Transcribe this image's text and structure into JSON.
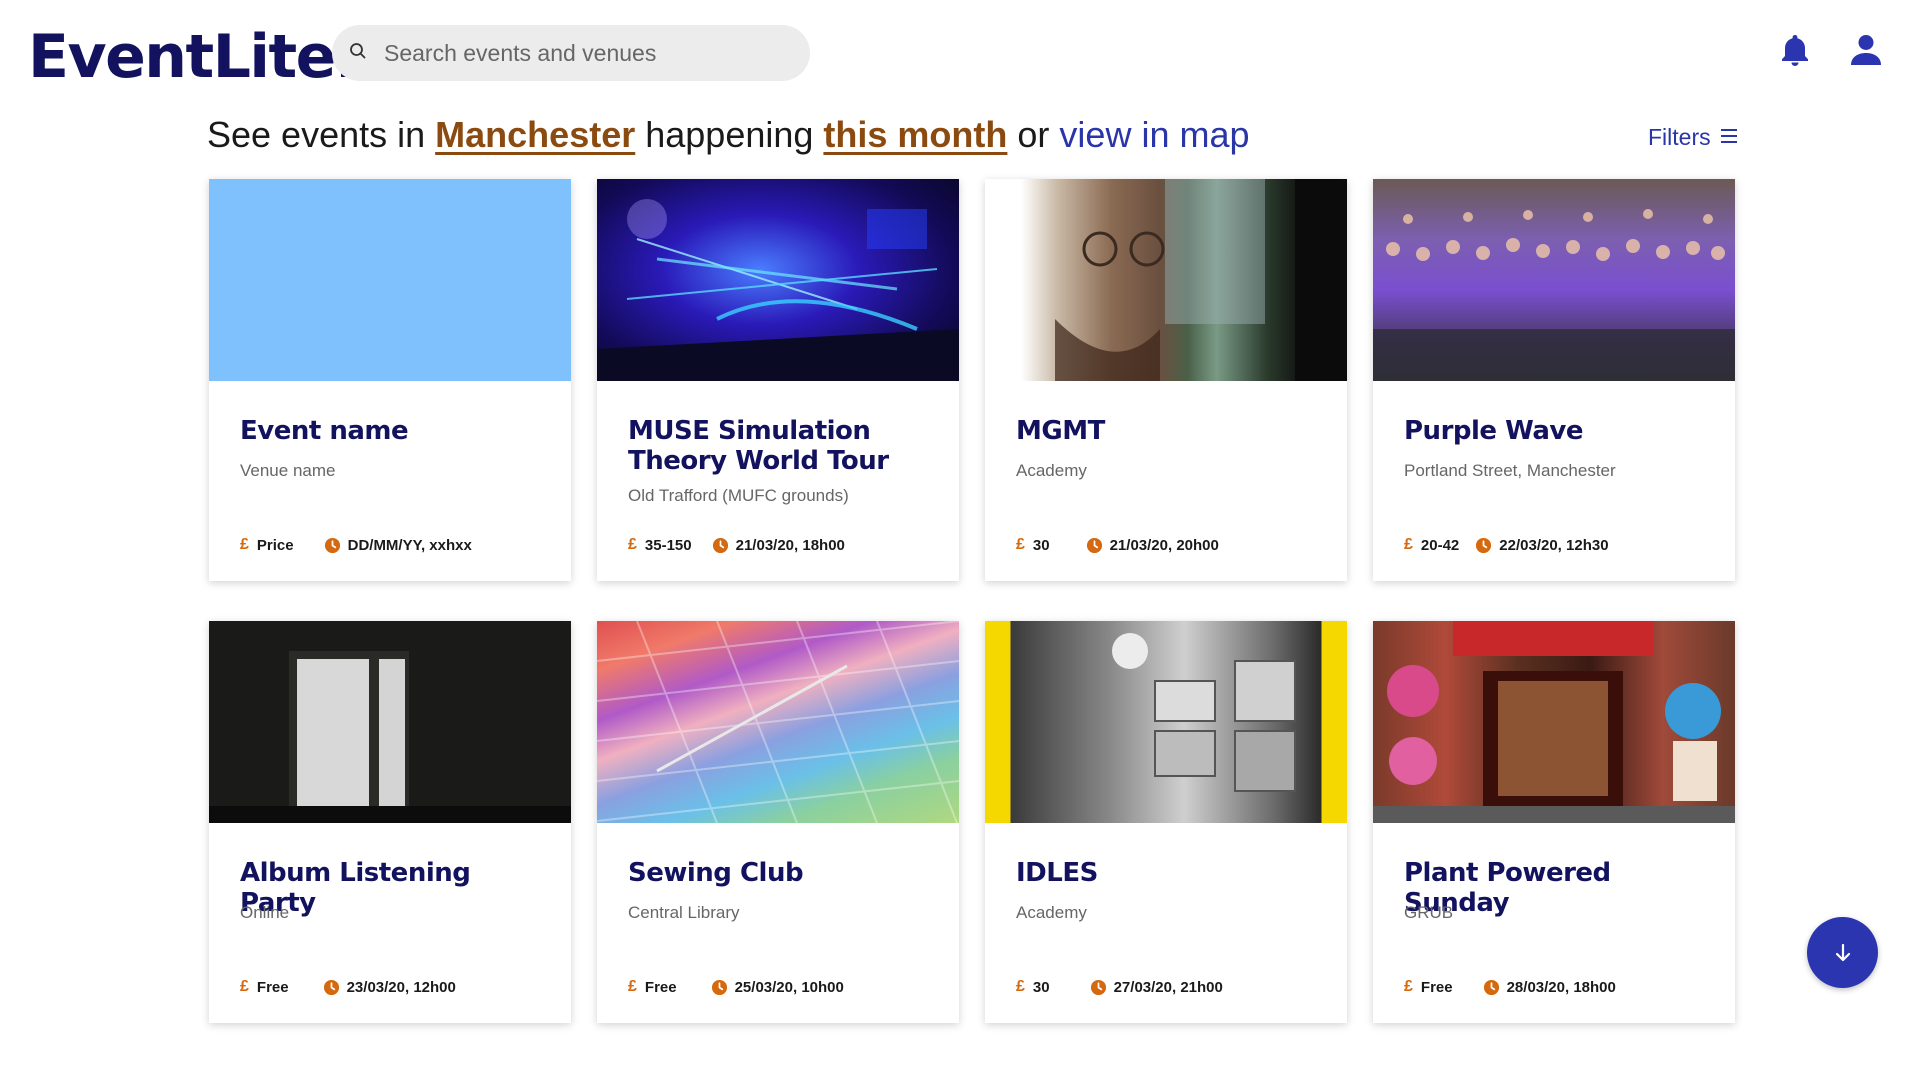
{
  "header": {
    "logo": "EventLite.",
    "search_placeholder": "Search events and venues",
    "icons": [
      "bell-icon",
      "user-icon"
    ]
  },
  "headline": {
    "prefix": "See events in ",
    "city": "Manchester",
    "middle": " happening ",
    "period": "this month",
    "or": " or ",
    "map_link": "view in map"
  },
  "filters": {
    "label": "Filters"
  },
  "currency_symbol": "£",
  "colors": {
    "brand": "#12125e",
    "accent": "#2a35a8",
    "orange": "#d4690f",
    "selection": "#8b4a10"
  },
  "events": [
    {
      "title": "Event name",
      "venue": "Venue name",
      "price": "Price",
      "datetime": "DD/MM/YY, xxhxx"
    },
    {
      "title": "MUSE Simulation Theory World Tour",
      "venue": "Old Trafford (MUFC grounds)",
      "price": "35-150",
      "datetime": "21/03/20, 18h00"
    },
    {
      "title": "MGMT",
      "venue": "Academy",
      "price": "30",
      "datetime": "21/03/20, 20h00"
    },
    {
      "title": "Purple Wave",
      "venue": "Portland Street, Manchester",
      "price": "20-42",
      "datetime": "22/03/20, 12h30"
    },
    {
      "title": "Album Listening Party",
      "venue": "Online",
      "price": "Free",
      "datetime": "23/03/20, 12h00"
    },
    {
      "title": "Sewing Club",
      "venue": "Central Library",
      "price": "Free",
      "datetime": "25/03/20, 10h00"
    },
    {
      "title": "IDLES",
      "venue": "Academy",
      "price": "30",
      "datetime": "27/03/20, 21h00"
    },
    {
      "title": "Plant Powered Sunday",
      "venue": "GRUB",
      "price": "Free",
      "datetime": "28/03/20, 18h00"
    }
  ],
  "scroll_button": {
    "icon": "arrow-down-icon"
  }
}
